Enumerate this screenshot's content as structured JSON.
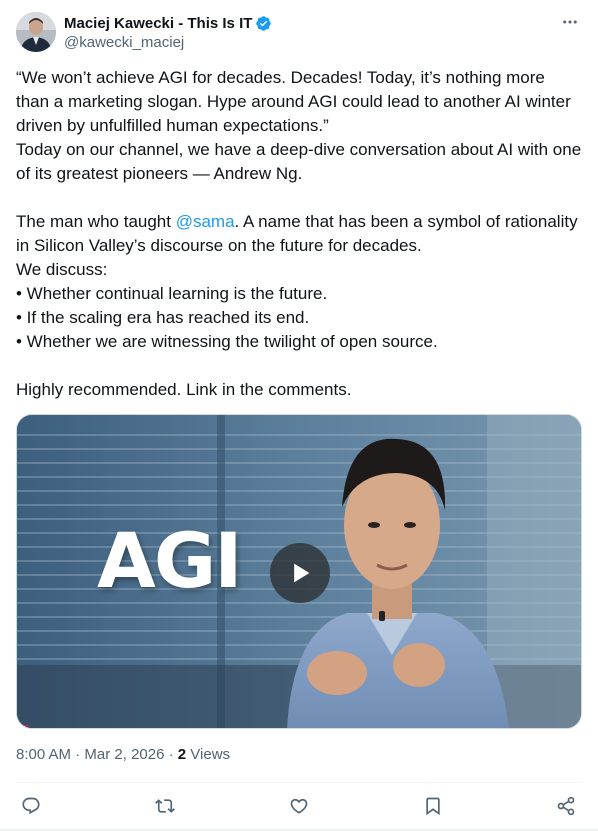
{
  "author": {
    "display_name": "Maciej Kawecki - This Is IT",
    "handle": "@kawecki_maciej",
    "verified": true,
    "avatar_icon": "person-avatar"
  },
  "tweet": {
    "paragraph_1": "“We won’t achieve AGI for decades. Decades! Today, it’s nothing more than a marketing slogan. Hype around AGI could lead to another AI winter driven by unfulfilled human expectations.”\nToday on our channel, we have a deep-dive conversation about AI with one of its greatest pioneers — Andrew Ng.",
    "para2_before_mention": "The man who taught ",
    "mention": "@sama",
    "para2_after_mention": ". A name that has been a symbol of rationality in Silicon Valley’s discourse on the future for decades.",
    "we_discuss": "We discuss:",
    "bullets": [
      "• Whether continual learning is the future.",
      "• If the scaling era has reached its end.",
      "• Whether we are witnessing the twilight of open source."
    ],
    "closing": "Highly recommended. Link in the comments."
  },
  "media": {
    "overlay_text": "AGI",
    "type": "video",
    "play_icon": "play-icon",
    "progress_fraction": 0.02
  },
  "meta": {
    "time": "8:00 AM",
    "separator": "·",
    "date": "Mar 2, 2026",
    "views_count": "2",
    "views_label": "Views"
  },
  "actions": [
    {
      "name": "reply",
      "icon": "reply-icon"
    },
    {
      "name": "repost",
      "icon": "repost-icon"
    },
    {
      "name": "like",
      "icon": "heart-icon"
    },
    {
      "name": "bookmark",
      "icon": "bookmark-icon"
    },
    {
      "name": "share",
      "icon": "share-icon"
    }
  ],
  "colors": {
    "accent": "#1d9bf0",
    "text_primary": "#0f1419",
    "text_secondary": "#536471",
    "progress": "#e0245e"
  }
}
